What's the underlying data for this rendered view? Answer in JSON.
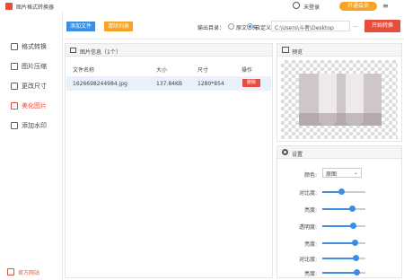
{
  "app": {
    "title": "图片格式转换器"
  },
  "header": {
    "login_text": "未登录",
    "vip_label": "开通会员",
    "menu_glyph": "≡"
  },
  "sidebar": {
    "items": [
      {
        "label": "格式转换"
      },
      {
        "label": "图片压缩"
      },
      {
        "label": "更改尺寸"
      },
      {
        "label": "美化图片",
        "active": true
      },
      {
        "label": "添加水印"
      }
    ],
    "official_site": "官方网站"
  },
  "toolbar": {
    "add_file": "添加文件",
    "clear_list": "清除列表",
    "output_dir_label": "输出目录：",
    "radio_source": "原文件夹",
    "radio_custom": "自定义",
    "path_value": "C:\\Users\\斗者\\Desktop",
    "more": "...",
    "start": "开始转换"
  },
  "file_list": {
    "title": "图片信息（1个）",
    "columns": [
      "文件名称",
      "大小",
      "尺寸",
      "操作"
    ],
    "rows": [
      {
        "name": "1626698244984.jpg",
        "size": "137.84KB",
        "dims": "1280*854",
        "action": "删除"
      }
    ]
  },
  "preview": {
    "title": "预览"
  },
  "settings": {
    "title": "设置",
    "color_label": "颜色:",
    "color_value": "原图",
    "sliders": [
      {
        "label": "对比度:",
        "value": 0.45
      },
      {
        "label": "亮度:",
        "value": 0.7
      },
      {
        "label": "透明度:",
        "value": 0.72
      },
      {
        "label": "亮度:",
        "value": 0.75
      },
      {
        "label": "对比度:",
        "value": 0.78
      },
      {
        "label": "亮度:",
        "value": 0.8
      }
    ]
  },
  "colors": {
    "accent_red": "#e64d3d",
    "accent_blue": "#3a8ee6",
    "accent_orange": "#f7a325"
  }
}
